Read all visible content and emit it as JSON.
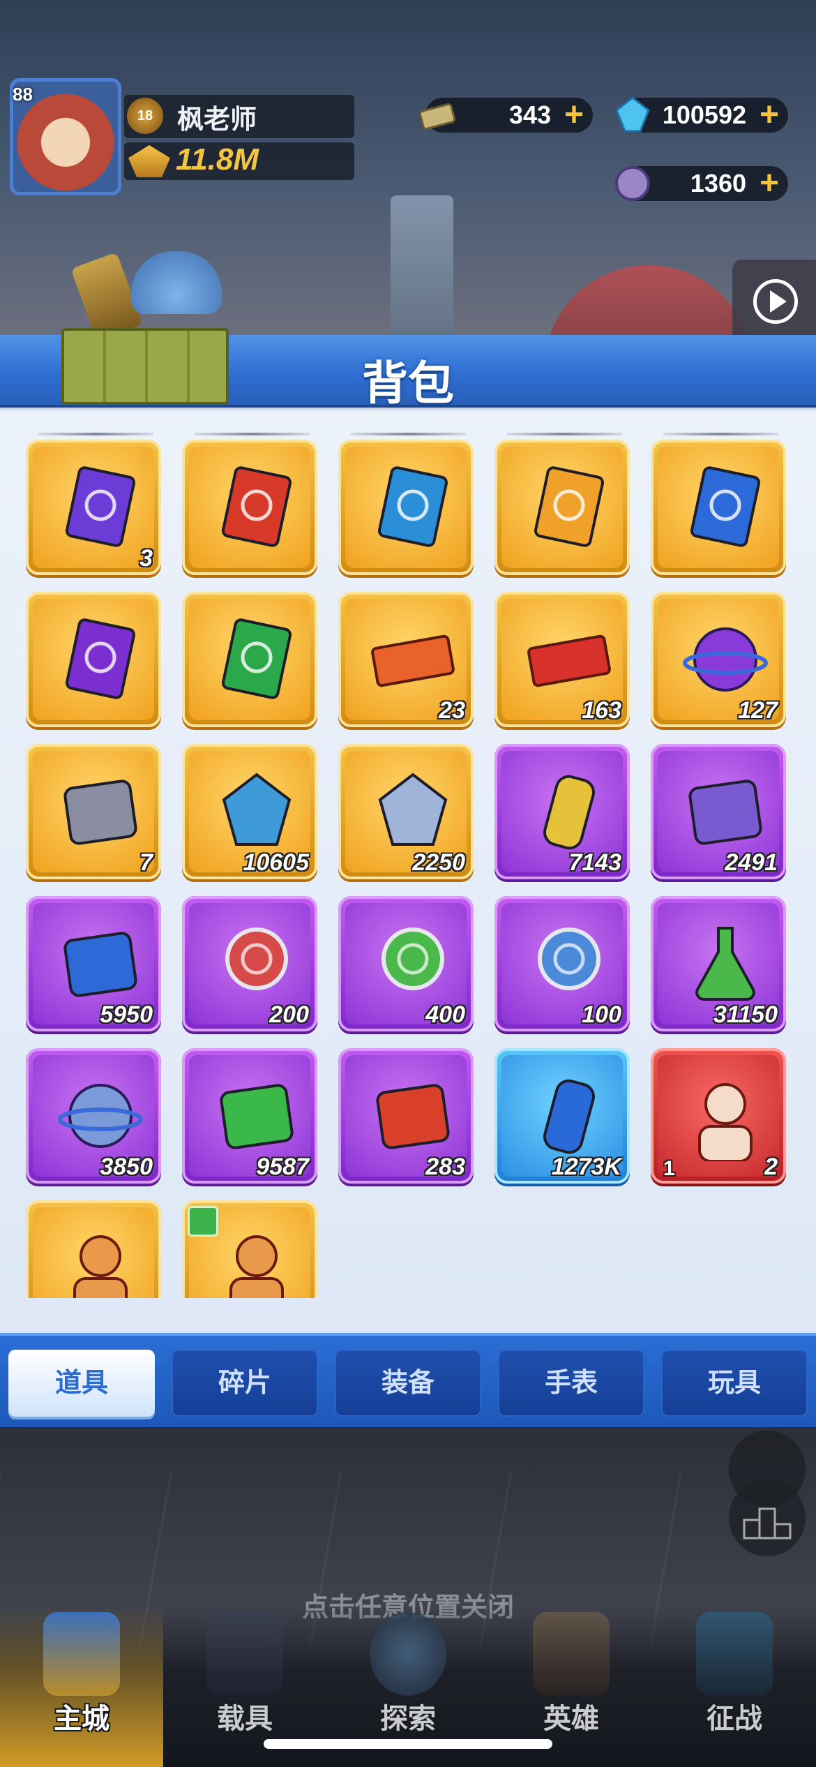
{
  "player": {
    "level": "88",
    "rank": "18",
    "name": "枫老师",
    "power": "11.8M"
  },
  "resources": [
    {
      "icon": "cash-icon",
      "value": "343"
    },
    {
      "icon": "diamond-icon",
      "value": "100592"
    },
    {
      "icon": "coin-icon",
      "value": "1360"
    }
  ],
  "panel": {
    "title": "背包"
  },
  "items": [
    {
      "icon": "purple-badge-book-icon",
      "rarity": "gold",
      "count": "3"
    },
    {
      "icon": "red-badge-book-icon",
      "rarity": "gold",
      "count": ""
    },
    {
      "icon": "blue-badge-book-icon",
      "rarity": "gold",
      "count": ""
    },
    {
      "icon": "orange-badge-book-icon",
      "rarity": "gold",
      "count": ""
    },
    {
      "icon": "blue-beetle-book-icon",
      "rarity": "gold",
      "count": ""
    },
    {
      "icon": "purple-sword-book-icon",
      "rarity": "gold",
      "count": ""
    },
    {
      "icon": "green-medic-book-icon",
      "rarity": "gold",
      "count": ""
    },
    {
      "icon": "orange-ticket-icon",
      "rarity": "gold",
      "count": "23"
    },
    {
      "icon": "red-ticket-icon",
      "rarity": "gold",
      "count": "163"
    },
    {
      "icon": "purple-orb-icon",
      "rarity": "gold",
      "count": "127"
    },
    {
      "icon": "mech-part-icon",
      "rarity": "gold",
      "count": "7"
    },
    {
      "icon": "rainbow-gem-icon",
      "rarity": "gold",
      "count": "10605"
    },
    {
      "icon": "crystal-ore-icon",
      "rarity": "gold",
      "count": "2250"
    },
    {
      "icon": "yellow-canister-icon",
      "rarity": "purple",
      "count": "7143"
    },
    {
      "icon": "tool-card-icon",
      "rarity": "purple",
      "count": "2491"
    },
    {
      "icon": "blue-chip-board-icon",
      "rarity": "purple",
      "count": "5950"
    },
    {
      "icon": "red-medal-icon",
      "rarity": "purple",
      "count": "200"
    },
    {
      "icon": "green-medal-icon",
      "rarity": "purple",
      "count": "400"
    },
    {
      "icon": "blue-medal-icon",
      "rarity": "purple",
      "count": "100"
    },
    {
      "icon": "green-potion-icon",
      "rarity": "purple",
      "count": "31150"
    },
    {
      "icon": "galaxy-potion-icon",
      "rarity": "purple",
      "count": "3850"
    },
    {
      "icon": "green-circuit-icon",
      "rarity": "purple",
      "count": "9587"
    },
    {
      "icon": "camera-gadget-icon",
      "rarity": "purple",
      "count": "283"
    },
    {
      "icon": "exp-can-icon",
      "rarity": "blue",
      "count": "1273K"
    },
    {
      "icon": "red-soldier-icon",
      "rarity": "red",
      "count": "2",
      "sub": "1"
    },
    {
      "icon": "orange-soldier-icon",
      "rarity": "gold",
      "count": ""
    },
    {
      "icon": "orange-soldier-icon",
      "rarity": "gold",
      "count": "",
      "badge": "green-emblem-icon"
    }
  ],
  "tabs": [
    {
      "label": "道具",
      "active": true
    },
    {
      "label": "碎片",
      "active": false
    },
    {
      "label": "装备",
      "active": false
    },
    {
      "label": "手表",
      "active": false
    },
    {
      "label": "玩具",
      "active": false
    }
  ],
  "close_hint": "点击任意位置关闭",
  "nav": [
    {
      "label": "主城",
      "active": true
    },
    {
      "label": "载具",
      "active": false
    },
    {
      "label": "探索",
      "active": false
    },
    {
      "label": "英雄",
      "active": false
    },
    {
      "label": "征战",
      "active": false
    }
  ],
  "colors": {
    "header": "#2e6cd0",
    "gold_frame": "#f4c24a",
    "purple_frame": "#c25af0",
    "blue_frame": "#57c6f8",
    "red_frame": "#f0524f"
  }
}
